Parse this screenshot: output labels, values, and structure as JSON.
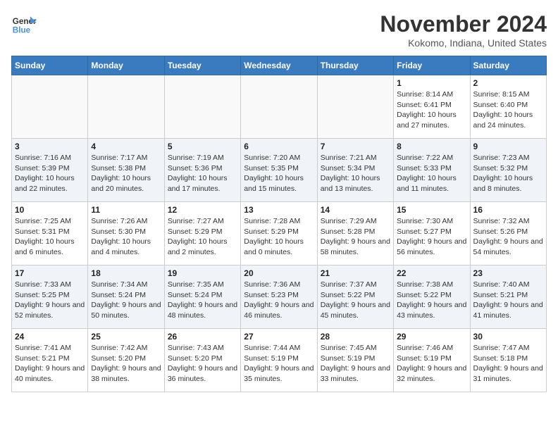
{
  "header": {
    "logo_general": "General",
    "logo_blue": "Blue",
    "month_title": "November 2024",
    "location": "Kokomo, Indiana, United States"
  },
  "days_of_week": [
    "Sunday",
    "Monday",
    "Tuesday",
    "Wednesday",
    "Thursday",
    "Friday",
    "Saturday"
  ],
  "weeks": [
    [
      {
        "day": "",
        "info": ""
      },
      {
        "day": "",
        "info": ""
      },
      {
        "day": "",
        "info": ""
      },
      {
        "day": "",
        "info": ""
      },
      {
        "day": "",
        "info": ""
      },
      {
        "day": "1",
        "info": "Sunrise: 8:14 AM\nSunset: 6:41 PM\nDaylight: 10 hours and 27 minutes."
      },
      {
        "day": "2",
        "info": "Sunrise: 8:15 AM\nSunset: 6:40 PM\nDaylight: 10 hours and 24 minutes."
      }
    ],
    [
      {
        "day": "3",
        "info": "Sunrise: 7:16 AM\nSunset: 5:39 PM\nDaylight: 10 hours and 22 minutes."
      },
      {
        "day": "4",
        "info": "Sunrise: 7:17 AM\nSunset: 5:38 PM\nDaylight: 10 hours and 20 minutes."
      },
      {
        "day": "5",
        "info": "Sunrise: 7:19 AM\nSunset: 5:36 PM\nDaylight: 10 hours and 17 minutes."
      },
      {
        "day": "6",
        "info": "Sunrise: 7:20 AM\nSunset: 5:35 PM\nDaylight: 10 hours and 15 minutes."
      },
      {
        "day": "7",
        "info": "Sunrise: 7:21 AM\nSunset: 5:34 PM\nDaylight: 10 hours and 13 minutes."
      },
      {
        "day": "8",
        "info": "Sunrise: 7:22 AM\nSunset: 5:33 PM\nDaylight: 10 hours and 11 minutes."
      },
      {
        "day": "9",
        "info": "Sunrise: 7:23 AM\nSunset: 5:32 PM\nDaylight: 10 hours and 8 minutes."
      }
    ],
    [
      {
        "day": "10",
        "info": "Sunrise: 7:25 AM\nSunset: 5:31 PM\nDaylight: 10 hours and 6 minutes."
      },
      {
        "day": "11",
        "info": "Sunrise: 7:26 AM\nSunset: 5:30 PM\nDaylight: 10 hours and 4 minutes."
      },
      {
        "day": "12",
        "info": "Sunrise: 7:27 AM\nSunset: 5:29 PM\nDaylight: 10 hours and 2 minutes."
      },
      {
        "day": "13",
        "info": "Sunrise: 7:28 AM\nSunset: 5:29 PM\nDaylight: 10 hours and 0 minutes."
      },
      {
        "day": "14",
        "info": "Sunrise: 7:29 AM\nSunset: 5:28 PM\nDaylight: 9 hours and 58 minutes."
      },
      {
        "day": "15",
        "info": "Sunrise: 7:30 AM\nSunset: 5:27 PM\nDaylight: 9 hours and 56 minutes."
      },
      {
        "day": "16",
        "info": "Sunrise: 7:32 AM\nSunset: 5:26 PM\nDaylight: 9 hours and 54 minutes."
      }
    ],
    [
      {
        "day": "17",
        "info": "Sunrise: 7:33 AM\nSunset: 5:25 PM\nDaylight: 9 hours and 52 minutes."
      },
      {
        "day": "18",
        "info": "Sunrise: 7:34 AM\nSunset: 5:24 PM\nDaylight: 9 hours and 50 minutes."
      },
      {
        "day": "19",
        "info": "Sunrise: 7:35 AM\nSunset: 5:24 PM\nDaylight: 9 hours and 48 minutes."
      },
      {
        "day": "20",
        "info": "Sunrise: 7:36 AM\nSunset: 5:23 PM\nDaylight: 9 hours and 46 minutes."
      },
      {
        "day": "21",
        "info": "Sunrise: 7:37 AM\nSunset: 5:22 PM\nDaylight: 9 hours and 45 minutes."
      },
      {
        "day": "22",
        "info": "Sunrise: 7:38 AM\nSunset: 5:22 PM\nDaylight: 9 hours and 43 minutes."
      },
      {
        "day": "23",
        "info": "Sunrise: 7:40 AM\nSunset: 5:21 PM\nDaylight: 9 hours and 41 minutes."
      }
    ],
    [
      {
        "day": "24",
        "info": "Sunrise: 7:41 AM\nSunset: 5:21 PM\nDaylight: 9 hours and 40 minutes."
      },
      {
        "day": "25",
        "info": "Sunrise: 7:42 AM\nSunset: 5:20 PM\nDaylight: 9 hours and 38 minutes."
      },
      {
        "day": "26",
        "info": "Sunrise: 7:43 AM\nSunset: 5:20 PM\nDaylight: 9 hours and 36 minutes."
      },
      {
        "day": "27",
        "info": "Sunrise: 7:44 AM\nSunset: 5:19 PM\nDaylight: 9 hours and 35 minutes."
      },
      {
        "day": "28",
        "info": "Sunrise: 7:45 AM\nSunset: 5:19 PM\nDaylight: 9 hours and 33 minutes."
      },
      {
        "day": "29",
        "info": "Sunrise: 7:46 AM\nSunset: 5:19 PM\nDaylight: 9 hours and 32 minutes."
      },
      {
        "day": "30",
        "info": "Sunrise: 7:47 AM\nSunset: 5:18 PM\nDaylight: 9 hours and 31 minutes."
      }
    ]
  ]
}
